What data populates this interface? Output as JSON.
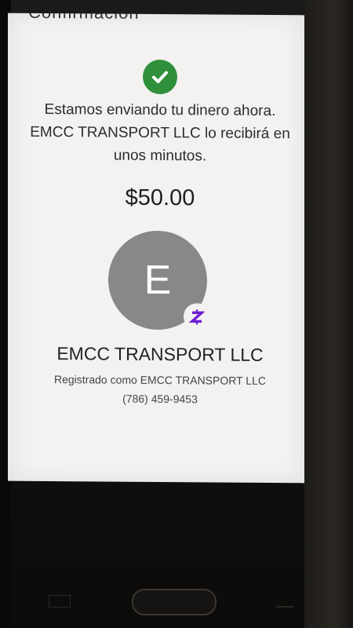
{
  "header": {
    "title": "Confirmación"
  },
  "confirmation": {
    "message": "Estamos enviando tu dinero ahora. EMCC TRANSPORT LLC lo recibirá en unos minutos.",
    "amount": "$50.00"
  },
  "recipient": {
    "initial": "E",
    "name": "EMCC TRANSPORT LLC",
    "registered_as": "Registrado como EMCC TRANSPORT LLC",
    "phone": "(786) 459-9453"
  },
  "colors": {
    "success": "#2f8f3b",
    "avatar": "#8a8886",
    "brand": "#6d1ed4"
  },
  "icons": {
    "success": "check-circle-icon",
    "badge": "zelle-logo-icon"
  }
}
